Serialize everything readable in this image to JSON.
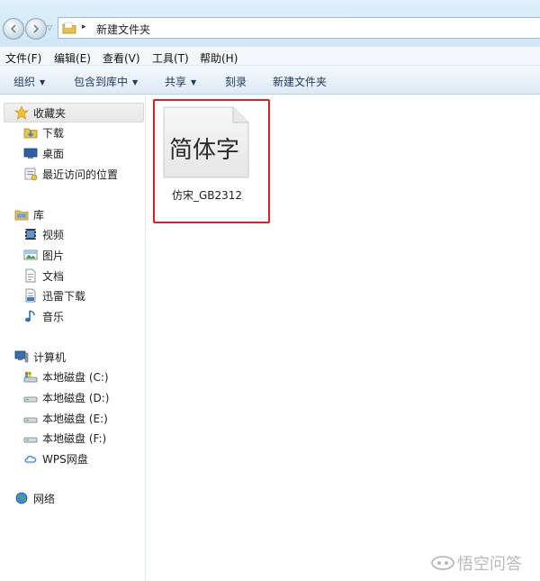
{
  "address_bar": {
    "path_segment": "新建文件夹",
    "separator": "▸"
  },
  "menu": {
    "items": [
      "文件(F)",
      "编辑(E)",
      "查看(V)",
      "工具(T)",
      "帮助(H)"
    ]
  },
  "toolbar": {
    "organize": "组织",
    "include_in_library": "包含到库中",
    "share": "共享",
    "burn": "刻录",
    "new_folder": "新建文件夹",
    "dropdown_arrow": "▼"
  },
  "navpane": {
    "favorites": {
      "label": "收藏夹",
      "items": [
        {
          "label": "下载",
          "icon": "downloads-folder-icon"
        },
        {
          "label": "桌面",
          "icon": "desktop-icon"
        },
        {
          "label": "最近访问的位置",
          "icon": "recent-places-icon"
        }
      ]
    },
    "libraries": {
      "label": "库",
      "items": [
        {
          "label": "视频",
          "icon": "video-library-icon"
        },
        {
          "label": "图片",
          "icon": "pictures-library-icon"
        },
        {
          "label": "文档",
          "icon": "documents-library-icon"
        },
        {
          "label": "迅雷下载",
          "icon": "thunder-downloads-icon"
        },
        {
          "label": "音乐",
          "icon": "music-library-icon"
        }
      ]
    },
    "computer": {
      "label": "计算机",
      "items": [
        {
          "label": "本地磁盘 (C:)",
          "icon": "system-drive-icon"
        },
        {
          "label": "本地磁盘 (D:)",
          "icon": "drive-icon"
        },
        {
          "label": "本地磁盘 (E:)",
          "icon": "drive-icon"
        },
        {
          "label": "本地磁盘 (F:)",
          "icon": "drive-icon"
        },
        {
          "label": "WPS网盘",
          "icon": "cloud-drive-icon"
        }
      ]
    },
    "network": {
      "label": "网络"
    }
  },
  "content": {
    "file": {
      "preview_text": "简体字",
      "name": "仿宋_GB2312"
    }
  },
  "watermark": {
    "text": "悟空问答"
  },
  "colors": {
    "highlight_border": "#e02020",
    "toolbar_text": "#1e395b"
  }
}
